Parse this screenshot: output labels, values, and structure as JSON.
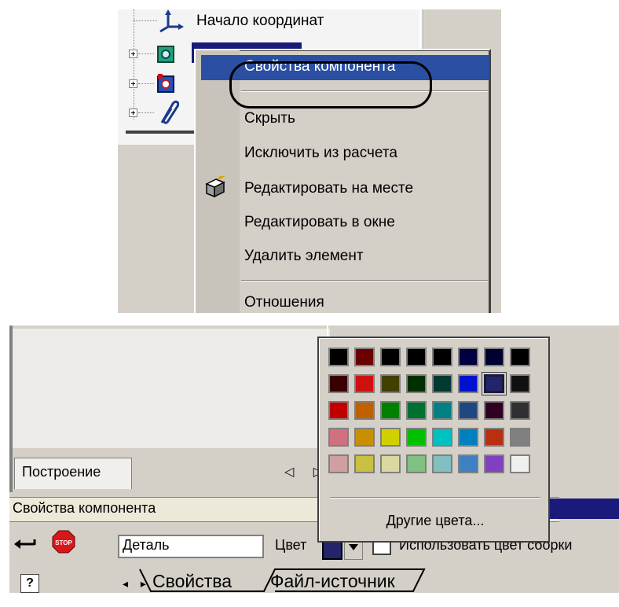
{
  "tree": {
    "origin_label": "Начало координат"
  },
  "context_menu": {
    "items": [
      {
        "label": "Свойства компонента",
        "highlighted": true
      },
      {
        "label": "Скрыть"
      },
      {
        "label": "Исключить из расчета"
      },
      {
        "label": "Редактировать на месте",
        "icon": "edit-in-place-icon"
      },
      {
        "label": "Редактировать в окне"
      },
      {
        "label": "Удалить элемент"
      },
      {
        "label": "Отношения"
      }
    ]
  },
  "tabs_top": {
    "build_label": "Построение"
  },
  "properties_panel": {
    "title": "Свойства компонента",
    "name_value": "Деталь",
    "color_label": "Цвет",
    "selected_color": "#24246a",
    "use_assembly_color_label": "Использовать цвет сборки",
    "use_assembly_color_checked": false,
    "bottom_tabs": [
      "Свойства",
      "Файл-источник"
    ]
  },
  "color_popup": {
    "palette": [
      [
        "#000000",
        "#6a0000",
        "#000000",
        "#000000",
        "#000000",
        "#000040",
        "#000030",
        "#000000"
      ],
      [
        "#3a0000",
        "#d01010",
        "#404000",
        "#003000",
        "#003a30",
        "#0010d0",
        "#24246a",
        "#101010"
      ],
      [
        "#c00000",
        "#c06000",
        "#008000",
        "#007030",
        "#008080",
        "#204880",
        "#300020",
        "#303030"
      ],
      [
        "#d07080",
        "#c89000",
        "#d0d000",
        "#00c000",
        "#00c0c0",
        "#0080c0",
        "#b83010",
        "#808080"
      ],
      [
        "#d0a0a0",
        "#c8c040",
        "#d8d8a0",
        "#80c080",
        "#80c0c0",
        "#4080c0",
        "#8040c0",
        "#f0f0f0"
      ]
    ],
    "selected_index": [
      1,
      6
    ],
    "more_colors_label": "Другие цвета..."
  }
}
